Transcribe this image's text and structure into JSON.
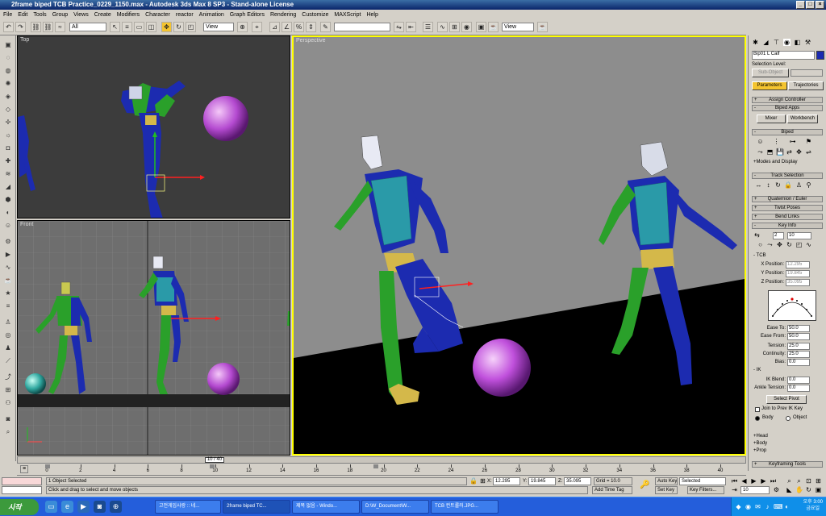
{
  "window": {
    "title": "2frame biped TCB Practice_0229_1150.max - Autodesk 3ds Max 8 SP3 - Stand-alone License"
  },
  "menu": [
    "File",
    "Edit",
    "Tools",
    "Group",
    "Views",
    "Create",
    "Modifiers",
    "Character",
    "reactor",
    "Animation",
    "Graph Editors",
    "Rendering",
    "Customize",
    "MAXScript",
    "Help"
  ],
  "toolbar": {
    "selection_filter": "All",
    "ref_coord": "View",
    "named_sel": "",
    "ref_coord2": "View"
  },
  "viewports": {
    "top": "Top",
    "front": "Front",
    "perspective": "Perspective"
  },
  "command_panel": {
    "object_name": "Bip01 L Calf",
    "selection_level_label": "Selection Level:",
    "selection_level_value": "Sub-Object",
    "tabs": [
      "Parameters",
      "Trajectories"
    ],
    "rollouts": {
      "assign_controller": "Assign Controller",
      "biped_apps": "Biped Apps",
      "biped": "Biped",
      "modes_display": "+Modes and Display",
      "track_selection": "Track Selection",
      "quaternion_euler": "Quaternion / Euler",
      "twist_poses": "Twist Poses",
      "bend_links": "Bend Links",
      "key_info": "Key Info",
      "keyframing_tools": "Keyframing Tools"
    },
    "buttons": {
      "mixer": "Mixer",
      "workbench": "Workbench",
      "select_pivot": "Select Pivot"
    },
    "key_info": {
      "key_number": "2",
      "key_time": "10",
      "tcb_label": "- TCB",
      "x_position_label": "X Position:",
      "x_position": "12.295",
      "y_position_label": "Y Position:",
      "y_position": "19.845",
      "z_position_label": "Z Position:",
      "z_position": "35.095",
      "ease_to_label": "Ease To:",
      "ease_to": "50.0",
      "ease_from_label": "Ease From:",
      "ease_from": "50.0",
      "tension_label": "Tension:",
      "tension": "25.0",
      "continuity_label": "Continuity:",
      "continuity": "25.0",
      "bias_label": "Bias:",
      "bias": "0.0",
      "ik_label": "- IK",
      "ik_blend_label": "IK Blend:",
      "ik_blend": "0.0",
      "ankle_tension_label": "Ankle Tension:",
      "ankle_tension": "0.0",
      "join_prev_ik": "Join to Prev IK Key",
      "body_label": "Body",
      "object_label": "Object",
      "head": "+Head",
      "body": "+Body",
      "prop": "+Prop"
    }
  },
  "timeline": {
    "frame_display": "10 / 40",
    "ticks": [
      "0",
      "2",
      "4",
      "6",
      "8",
      "10",
      "12",
      "14",
      "16",
      "18",
      "20",
      "22",
      "24",
      "26",
      "28",
      "30",
      "32",
      "34",
      "36",
      "38",
      "40"
    ]
  },
  "status": {
    "selected": "1 Object Selected",
    "prompt": "Click and drag to select and move objects",
    "x_label": "X:",
    "x": "12.295",
    "y_label": "Y:",
    "y": "19.845",
    "z_label": "Z:",
    "z": "35.095",
    "grid": "Grid = 10.0",
    "add_time_tag": "Add Time Tag",
    "auto_key": "Auto Key",
    "set_key": "Set Key",
    "key_mode": "Selected",
    "key_filters": "Key Filters...",
    "current_frame": "10"
  },
  "taskbar": {
    "start": "시작",
    "tasks": [
      "고전게임사랑 :: 네...",
      "2frame biped TC...",
      "제목 없음 - Windo...",
      "D:\\W_Document\\W...",
      "TCB 컨트롤러.JPG..."
    ],
    "clock_time": "오후 3:00",
    "clock_day": "금요일"
  }
}
